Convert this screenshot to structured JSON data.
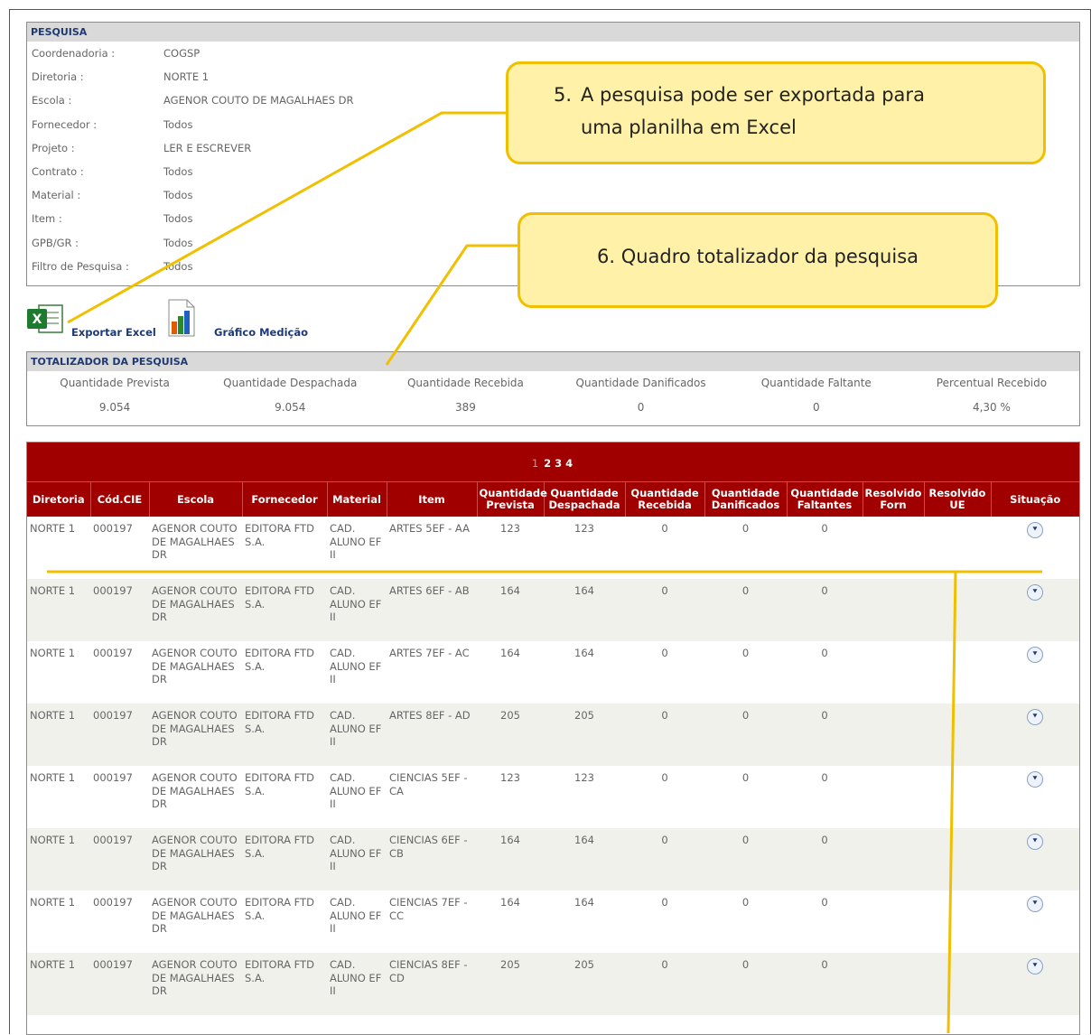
{
  "pesquisa": {
    "title": "PESQUISA",
    "fields": [
      {
        "label": "Coordenadoria :",
        "value": "COGSP"
      },
      {
        "label": "Diretoria :",
        "value": "NORTE 1"
      },
      {
        "label": "Escola :",
        "value": "AGENOR COUTO DE MAGALHAES DR"
      },
      {
        "label": "Fornecedor :",
        "value": "Todos"
      },
      {
        "label": "Projeto :",
        "value": "LER E ESCREVER"
      },
      {
        "label": "Contrato :",
        "value": "Todos"
      },
      {
        "label": "Material :",
        "value": "Todos"
      },
      {
        "label": "Item :",
        "value": "Todos"
      },
      {
        "label": "GPB/GR :",
        "value": "Todos"
      },
      {
        "label": "Filtro de Pesquisa :",
        "value": "Todos"
      }
    ]
  },
  "toolbar": {
    "export_label": "Exportar Excel",
    "chart_label": "Gráfico Medição",
    "export_icon": "excel-icon",
    "chart_icon": "bar-chart-icon"
  },
  "totalizador": {
    "title": "TOTALIZADOR DA PESQUISA",
    "items": [
      {
        "label": "Quantidade Prevista",
        "value": "9.054"
      },
      {
        "label": "Quantidade Despachada",
        "value": "9.054"
      },
      {
        "label": "Quantidade Recebida",
        "value": "389"
      },
      {
        "label": "Quantidade Danificados",
        "value": "0"
      },
      {
        "label": "Quantidade Faltante",
        "value": "0"
      },
      {
        "label": "Percentual Recebido",
        "value": "4,30 %"
      }
    ]
  },
  "pager": {
    "current": "1",
    "pages": [
      "2",
      "3",
      "4"
    ]
  },
  "table": {
    "headers": [
      "Diretoria",
      "Cód.CIE",
      "Escola",
      "Fornecedor",
      "Material",
      "Item",
      "Quantidade Prevista",
      "Quantidade Despachada",
      "Quantidade Recebida",
      "Quantidade Danificados",
      "Quantidade Faltantes",
      "Resolvido Forn",
      "Resolvido UE",
      "Situação"
    ],
    "rows": [
      {
        "diretoria": "NORTE 1",
        "cie": "000197",
        "escola": "AGENOR COUTO DE MAGALHAES DR",
        "fornecedor": "EDITORA FTD S.A.",
        "material": "CAD. ALUNO EF II",
        "item": "ARTES 5EF - AA",
        "prevista": "123",
        "despachada": "123",
        "recebida": "0",
        "danificados": "0",
        "faltantes": "0",
        "res_forn": "",
        "res_ue": ""
      },
      {
        "diretoria": "NORTE 1",
        "cie": "000197",
        "escola": "AGENOR COUTO DE MAGALHAES DR",
        "fornecedor": "EDITORA FTD S.A.",
        "material": "CAD. ALUNO EF II",
        "item": "ARTES 6EF - AB",
        "prevista": "164",
        "despachada": "164",
        "recebida": "0",
        "danificados": "0",
        "faltantes": "0",
        "res_forn": "",
        "res_ue": ""
      },
      {
        "diretoria": "NORTE 1",
        "cie": "000197",
        "escola": "AGENOR COUTO DE MAGALHAES DR",
        "fornecedor": "EDITORA FTD S.A.",
        "material": "CAD. ALUNO EF II",
        "item": "ARTES 7EF - AC",
        "prevista": "164",
        "despachada": "164",
        "recebida": "0",
        "danificados": "0",
        "faltantes": "0",
        "res_forn": "",
        "res_ue": ""
      },
      {
        "diretoria": "NORTE 1",
        "cie": "000197",
        "escola": "AGENOR COUTO DE MAGALHAES DR",
        "fornecedor": "EDITORA FTD S.A.",
        "material": "CAD. ALUNO EF II",
        "item": "ARTES 8EF - AD",
        "prevista": "205",
        "despachada": "205",
        "recebida": "0",
        "danificados": "0",
        "faltantes": "0",
        "res_forn": "",
        "res_ue": ""
      },
      {
        "diretoria": "NORTE 1",
        "cie": "000197",
        "escola": "AGENOR COUTO DE MAGALHAES DR",
        "fornecedor": "EDITORA FTD S.A.",
        "material": "CAD. ALUNO EF II",
        "item": "CIENCIAS 5EF - CA",
        "prevista": "123",
        "despachada": "123",
        "recebida": "0",
        "danificados": "0",
        "faltantes": "0",
        "res_forn": "",
        "res_ue": ""
      },
      {
        "diretoria": "NORTE 1",
        "cie": "000197",
        "escola": "AGENOR COUTO DE MAGALHAES DR",
        "fornecedor": "EDITORA FTD S.A.",
        "material": "CAD. ALUNO EF II",
        "item": "CIENCIAS 6EF - CB",
        "prevista": "164",
        "despachada": "164",
        "recebida": "0",
        "danificados": "0",
        "faltantes": "0",
        "res_forn": "",
        "res_ue": ""
      },
      {
        "diretoria": "NORTE 1",
        "cie": "000197",
        "escola": "AGENOR COUTO DE MAGALHAES DR",
        "fornecedor": "EDITORA FTD S.A.",
        "material": "CAD. ALUNO EF II",
        "item": "CIENCIAS 7EF - CC",
        "prevista": "164",
        "despachada": "164",
        "recebida": "0",
        "danificados": "0",
        "faltantes": "0",
        "res_forn": "",
        "res_ue": ""
      },
      {
        "diretoria": "NORTE 1",
        "cie": "000197",
        "escola": "AGENOR COUTO DE MAGALHAES DR",
        "fornecedor": "EDITORA FTD S.A.",
        "material": "CAD. ALUNO EF II",
        "item": "CIENCIAS 8EF - CD",
        "prevista": "205",
        "despachada": "205",
        "recebida": "0",
        "danificados": "0",
        "faltantes": "0",
        "res_forn": "",
        "res_ue": ""
      }
    ],
    "situacao_icon": "expand-chevron-icon"
  },
  "annotations": {
    "callout5_num": "5.",
    "callout5_line1": "A pesquisa pode ser exportada para",
    "callout5_line2": "uma planilha em Excel",
    "callout6_text": "6.  Quadro totalizador da pesquisa",
    "line_color": "#f0c000"
  },
  "colors": {
    "header_red": "#a00000",
    "title_blue": "#1f3a73",
    "alt_row": "#f1f1ec"
  }
}
